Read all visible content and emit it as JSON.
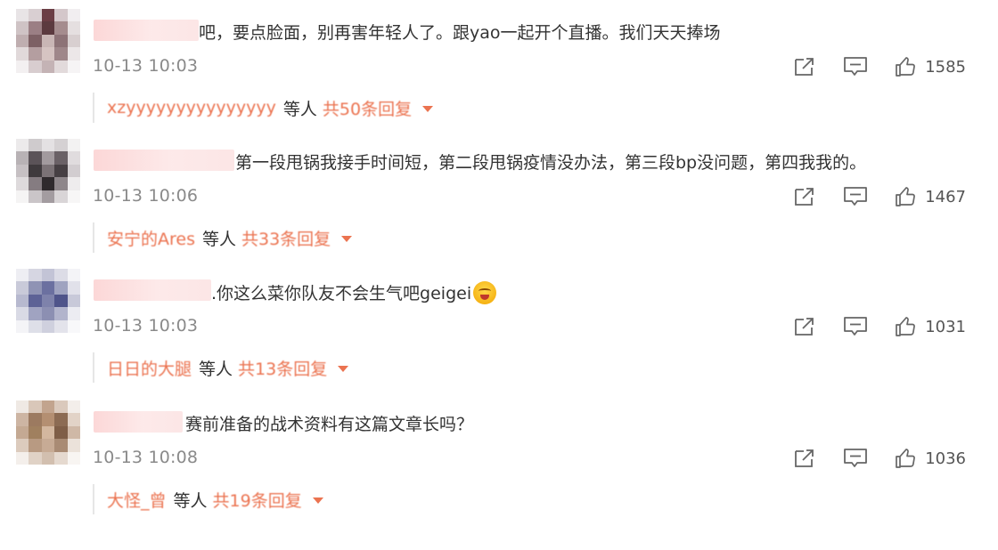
{
  "comments": [
    {
      "text": "吧，要点脸面，别再害年轻人了。跟yao一起开个直播。我们天天捧场",
      "time": "10-13 10:03",
      "likes": "1585",
      "reply_name": "xzyyyyyyyyyyyyyyy",
      "reply_mid": "等人",
      "reply_count": "共50条回复"
    },
    {
      "text": "第一段甩锅我接手时间短，第二段甩锅疫情没办法，第三段bp没问题，第四我我的。",
      "time": "10-13 10:06",
      "likes": "1467",
      "reply_name": "安宁的Ares",
      "reply_mid": "等人",
      "reply_count": "共33条回复"
    },
    {
      "text": ".你这么菜你队友不会生气吧geigei",
      "time": "10-13 10:03",
      "likes": "1031",
      "reply_name": "日日的大腿",
      "reply_mid": "等人",
      "reply_count": "共13条回复"
    },
    {
      "text": "赛前准备的战术资料有这篇文章长吗？",
      "time": "10-13 10:08",
      "likes": "1036",
      "reply_name": "大怪_曾",
      "reply_mid": "等人",
      "reply_count": "共19条回复"
    }
  ],
  "icons": {
    "share": "share-icon",
    "comment": "comment-icon",
    "like": "thumbs-up-icon",
    "expand": "caret-down-icon",
    "emoji": "grinning-emoji-icon"
  },
  "colors": {
    "reply_accent": "#eb7350",
    "timestamp": "#8a8a8a",
    "body_text": "#333333"
  }
}
